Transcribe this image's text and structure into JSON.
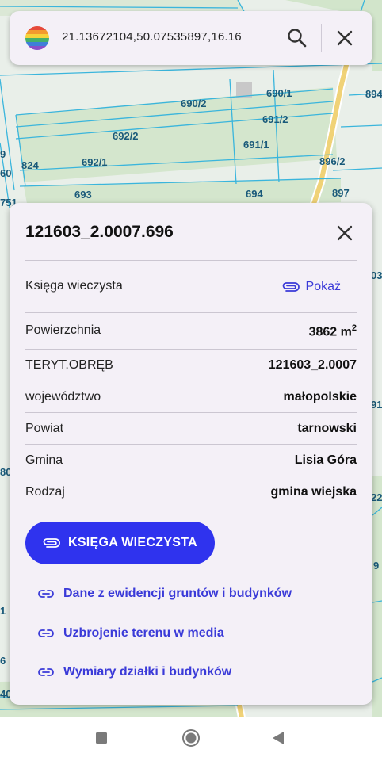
{
  "search": {
    "query": "21.13672104,50.07535897,16.16"
  },
  "map": {
    "parcel_labels": [
      "690/2",
      "690/1",
      "894",
      "692/2",
      "691/2",
      "691/1",
      "692/1",
      "824",
      "896/2",
      "693",
      "694",
      "897",
      "751",
      "9",
      "60",
      "03",
      "91",
      "80",
      "22",
      "9",
      "1",
      "6",
      "40"
    ]
  },
  "details": {
    "title": "121603_2.0007.696",
    "land_register": {
      "label": "Księga wieczysta",
      "action": "Pokaż"
    },
    "rows": [
      {
        "label": "Powierzchnia",
        "value": "3862 m",
        "sup": "2"
      },
      {
        "label": "TERYT.OBRĘB",
        "value": "121603_2.0007"
      },
      {
        "label": "województwo",
        "value": "małopolskie"
      },
      {
        "label": "Powiat",
        "value": "tarnowski"
      },
      {
        "label": "Gmina",
        "value": "Lisia Góra"
      },
      {
        "label": "Rodzaj",
        "value": "gmina wiejska"
      }
    ],
    "primary_button": "KSIĘGA WIECZYSTA",
    "links": [
      "Dane z ewidencji gruntów i budynków",
      "Uzbrojenie terenu w media",
      "Wymiary działki i budynków"
    ]
  },
  "colors": {
    "accent": "#2f33ee",
    "link": "#3a3ad8",
    "card_bg": "#f4f0f7",
    "parcel_label": "#1a5a7a"
  },
  "icons": {
    "search_logo": "rainbow-globe-icon",
    "search": "search-icon",
    "close": "close-icon",
    "attachment": "paperclip-icon",
    "link": "link-icon",
    "nav": [
      "recents-square-icon",
      "home-circle-icon",
      "back-triangle-icon"
    ]
  }
}
